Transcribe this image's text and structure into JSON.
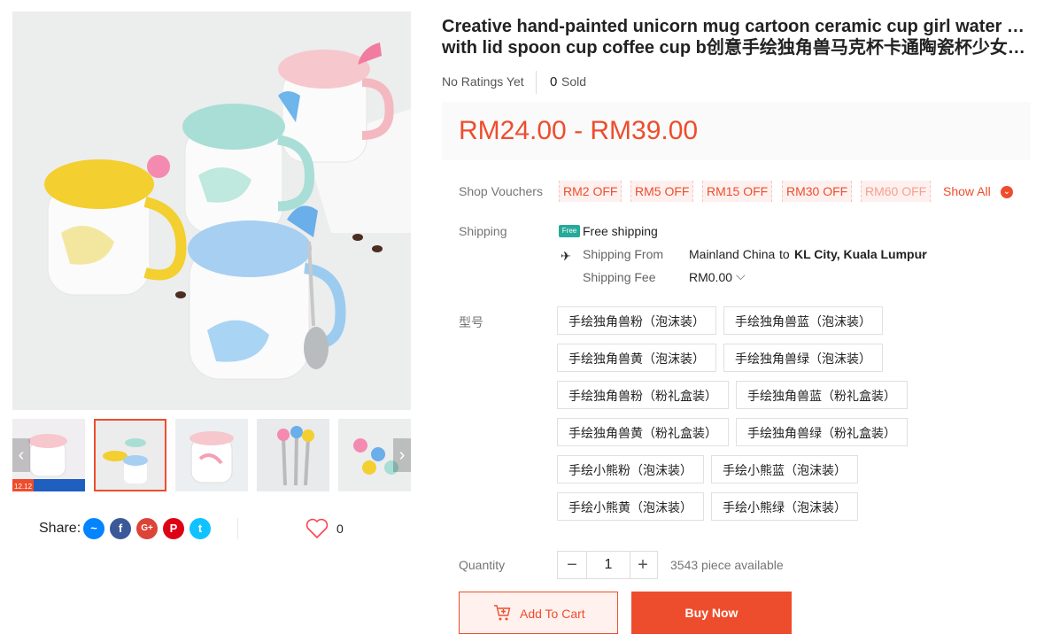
{
  "product": {
    "title_line1": "Creative hand-painted unicorn mug cartoon ceramic cup girl water cup",
    "title_line2": "with lid spoon cup coffee cup b创意手绘独角兽马克杯卡通陶瓷杯少女水...",
    "ratings": "No Ratings Yet",
    "sold_count": "0",
    "sold_label": "Sold",
    "price": "RM24.00 - RM39.00"
  },
  "vouchers": {
    "label": "Shop Vouchers",
    "items": [
      "RM2 OFF",
      "RM5 OFF",
      "RM15 OFF",
      "RM30 OFF",
      "RM60 OFF"
    ],
    "show_all": "Show All"
  },
  "shipping": {
    "label": "Shipping",
    "free_badge": "Free",
    "free_text": "Free shipping",
    "from_label": "Shipping From",
    "from_value": "Mainland China",
    "to_label": "to",
    "to_value": "KL City, Kuala Lumpur",
    "fee_label": "Shipping Fee",
    "fee_value": "RM0.00"
  },
  "variation": {
    "label": "型号",
    "options": [
      "手绘独角兽粉（泡沫装）",
      "手绘独角兽蓝（泡沫装）",
      "手绘独角兽黄（泡沫装）",
      "手绘独角兽绿（泡沫装）",
      "手绘独角兽粉（粉礼盒装）",
      "手绘独角兽蓝（粉礼盒装）",
      "手绘独角兽黄（粉礼盒装）",
      "手绘独角兽绿（粉礼盒装）",
      "手绘小熊粉（泡沫装）",
      "手绘小熊蓝（泡沫装）",
      "手绘小熊黄（泡沫装）",
      "手绘小熊绿（泡沫装）"
    ]
  },
  "quantity": {
    "label": "Quantity",
    "value": "1",
    "available": "3543 piece available"
  },
  "actions": {
    "add_to_cart": "Add To Cart",
    "buy_now": "Buy Now"
  },
  "share": {
    "label": "Share:",
    "icons": [
      "messenger-icon",
      "facebook-icon",
      "google-plus-icon",
      "pinterest-icon",
      "twitter-icon"
    ]
  },
  "favorite": {
    "count": "0"
  },
  "thumb_badge": "12.12",
  "colors": {
    "accent": "#ee4d2d",
    "free_shipping": "#26aa99",
    "price_bg": "#fafafa"
  }
}
